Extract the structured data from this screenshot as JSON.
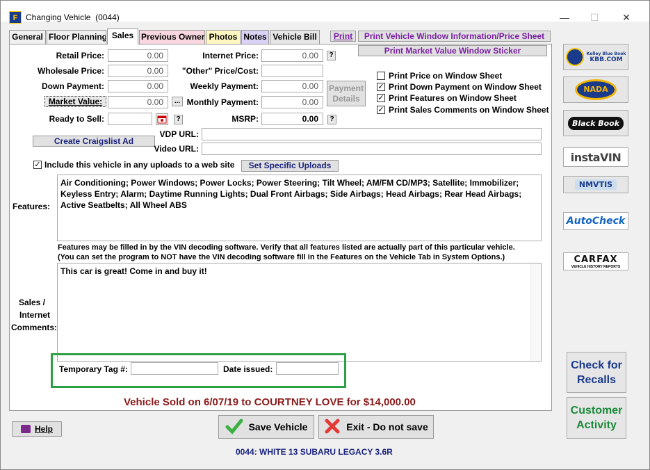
{
  "window": {
    "title": "Changing Vehicle",
    "code": "(0044)",
    "minimize": "—",
    "maximize": "☐",
    "close": "✕"
  },
  "tabs": [
    {
      "label": "General"
    },
    {
      "label": "Floor Planning"
    },
    {
      "label": "Sales"
    },
    {
      "label": "Previous Owner"
    },
    {
      "label": "Photos"
    },
    {
      "label": "Notes"
    },
    {
      "label": "Vehicle Bill"
    }
  ],
  "toolbar": {
    "print": "Print",
    "print_window_info": "Print Vehicle Window Information/Price Sheet",
    "print_market_value": "Print Market Value Window Sticker"
  },
  "pricing": {
    "retail_price_label": "Retail Price:",
    "retail_price": "0.00",
    "wholesale_price_label": "Wholesale Price:",
    "wholesale_price": "0.00",
    "down_payment_label": "Down Payment:",
    "down_payment": "0.00",
    "market_value_label": "Market Value:",
    "market_value": "0.00",
    "market_value_btn": "...",
    "ready_to_sell_label": "Ready to Sell:",
    "ready_to_sell": "",
    "internet_price_label": "Internet Price:",
    "internet_price": "0.00",
    "other_price_label": "\"Other\" Price/Cost:",
    "other_price": "",
    "weekly_payment_label": "Weekly Payment:",
    "weekly_payment": "0.00",
    "monthly_payment_label": "Monthly Payment:",
    "monthly_payment": "0.00",
    "msrp_label": "MSRP:",
    "msrp": "0.00",
    "payment_details": "Payment Details",
    "help_q": "?"
  },
  "checks": {
    "price_on_sheet": {
      "label": "Print Price on Window Sheet",
      "checked": false
    },
    "down_on_sheet": {
      "label": "Print Down Payment on Window Sheet",
      "checked": true
    },
    "features_on_sheet": {
      "label": "Print Features on Window Sheet",
      "checked": true
    },
    "sales_comments": {
      "label": "Print Sales Comments on Window Sheet",
      "checked": true
    },
    "include_uploads": {
      "label": "Include this vehicle in any uploads to a web site",
      "checked": true
    },
    "check_mark": "✓"
  },
  "web": {
    "craigslist": "Create Craigslist Ad",
    "vdp_label": "VDP URL:",
    "vdp": "",
    "video_label": "Video URL:",
    "video": "",
    "set_uploads": "Set Specific Uploads"
  },
  "features": {
    "label": "Features:",
    "text": "Air Conditioning; Power Windows; Power Locks; Power Steering; Tilt Wheel; AM/FM CD/MP3; Satellite; Immobilizer; Keyless Entry; Alarm; Daytime Running Lights; Dual Front Airbags; Side Airbags; Head Airbags; Rear Head Airbags; Active Seatbelts; All Wheel ABS",
    "note1": "Features may be filled in by the VIN decoding software.  Verify that all features listed are actually part of this particular vehicle.",
    "note2": "(You can set the program to NOT have the VIN decoding software  fill in the Features on the Vehicle Tab in System Options.)"
  },
  "comments": {
    "label_line1": "Sales /",
    "label_line2": "Internet",
    "label_line3": "Comments:",
    "text": "This car is great! Come in and buy it!"
  },
  "temp_tag": {
    "label": "Temporary Tag #:",
    "value": "",
    "date_label": "Date issued:",
    "date": ""
  },
  "sold": {
    "text": "Vehicle Sold on  6/07/19 to COURTNEY LOVE for $14,000.00"
  },
  "buttons": {
    "help": "Help",
    "save": "Save Vehicle",
    "exit": "Exit - Do not save"
  },
  "footer": {
    "vehicle": "0044: WHITE 13 SUBARU LEGACY 3.6R"
  },
  "side": {
    "kbb_top": "Kelley Blue Book",
    "kbb": "KBB.COM",
    "nada": "NADA",
    "blackbook": "Black Book",
    "instavin": "instaVIN",
    "nmvtis": "NMVTIS",
    "autocheck": "AutoCheck",
    "carfax": "CARFAX",
    "carfax_sub": "VEHICLE HISTORY REPORTS",
    "recalls": "Check for Recalls",
    "activity": "Customer Activity"
  }
}
